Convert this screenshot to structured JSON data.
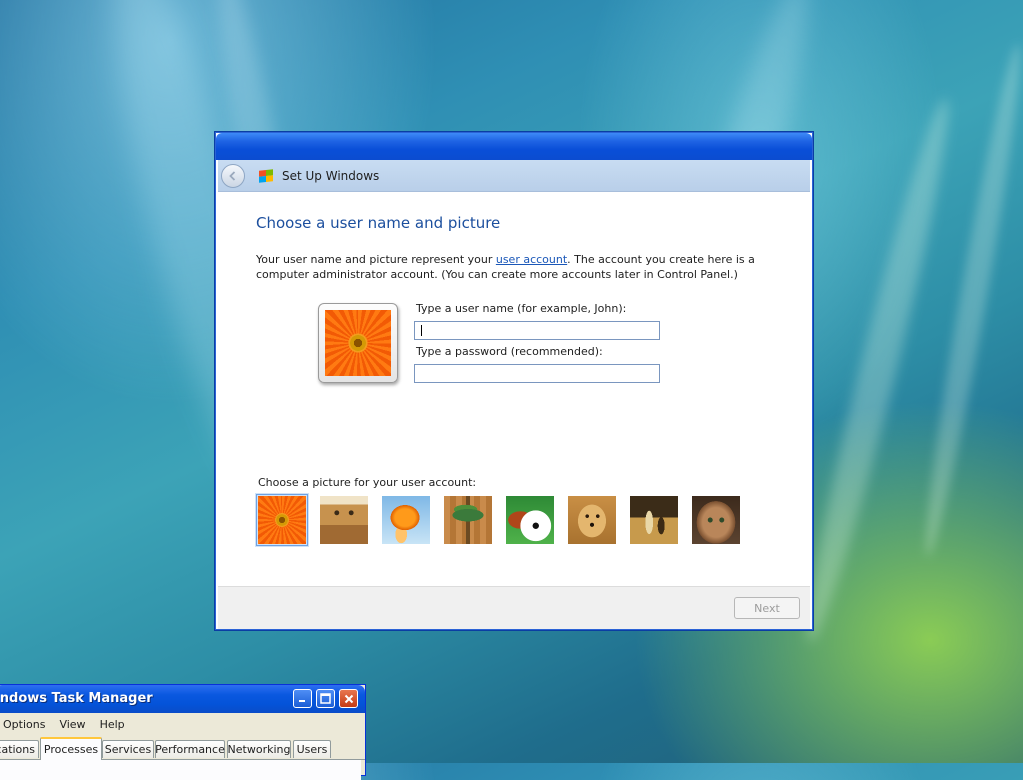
{
  "setup_window": {
    "nav_title": "Set Up Windows",
    "heading": "Choose a user name and picture",
    "intro": {
      "before_link": "Your user name and picture represent your ",
      "link": "user account",
      "after_link": ". The account you create here is a computer administrator account. (You can create more accounts later in Control Panel.)"
    },
    "username_label": "Type a user name (for example, John):",
    "username_value": "",
    "password_label": "Type a password (recommended):",
    "password_value": "",
    "picture_label": "Choose a picture for your user account:",
    "pictures": [
      "gerbera",
      "robot",
      "goldfish",
      "bonsai",
      "ball",
      "puppy",
      "chess",
      "kitten"
    ],
    "selected_picture": "gerbera",
    "next_label": "Next",
    "next_enabled": false
  },
  "task_manager": {
    "title": "Windows Task Manager",
    "menu": [
      "Options",
      "View",
      "Help"
    ],
    "tabs": [
      "Applications",
      "Processes",
      "Services",
      "Performance",
      "Networking",
      "Users"
    ],
    "active_tab": "Processes"
  },
  "colors": {
    "heading": "#1c4f9e",
    "link": "#1a57b8",
    "title_bar": "#0a4fd8",
    "nav_bar": "#c8dcf2"
  }
}
